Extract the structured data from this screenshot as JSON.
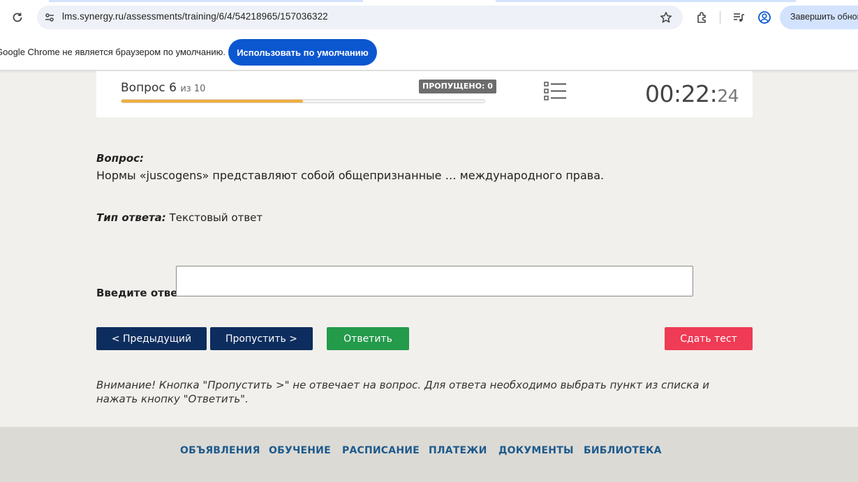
{
  "browser": {
    "url": "lms.synergy.ru/assessments/training/6/4/54218965/157036322",
    "update_button": "Завершить обновление",
    "icons": [
      "reload-icon",
      "site-info-icon",
      "star-icon",
      "extensions-icon",
      "media-icon",
      "profile-icon"
    ]
  },
  "infobar": {
    "message": "Google Chrome не является браузером по умолчанию.",
    "button": "Использовать по умолчанию"
  },
  "test_header": {
    "question_word": "Вопрос 6",
    "of_total": "из 10",
    "progress": 0.5,
    "skipped_label": "ПРОПУЩЕНО: 0",
    "timer_main": "00:22",
    "timer_sep": ":",
    "timer_secs": "24",
    "list_icon": "list-icon"
  },
  "question": {
    "label": "Вопрос:",
    "text": "Нормы «juscogens» представляют собой общепризнанные … международного права.",
    "type_label": "Тип ответа:",
    "type_value": "Текстовый ответ",
    "answer_label": "Введите ответ:",
    "answer_value": ""
  },
  "buttons": {
    "prev": "< Предыдущий",
    "skip": "Пропустить >",
    "answer": "Ответить",
    "submit": "Сдать тест"
  },
  "warning": "Внимание! Кнопка \"Пропустить >\" не отвечает на вопрос. Для ответа необходимо выбрать пункт из списка и нажать кнопку \"Ответить\".",
  "footer_nav": [
    "ОБЪЯВЛЕНИЯ",
    "ОБУЧЕНИЕ",
    "РАСПИСАНИЕ",
    "ПЛАТЕЖИ",
    "ДОКУМЕНТЫ",
    "БИБЛИОТЕКА"
  ],
  "colors": {
    "accent_blue": "#0b57d0",
    "nav_dark": "#0d2d5e",
    "answer_green": "#249a4b",
    "submit_red": "#ef3b55",
    "progress_orange": "#f0ad3c",
    "footer_link": "#1d5a8c"
  }
}
